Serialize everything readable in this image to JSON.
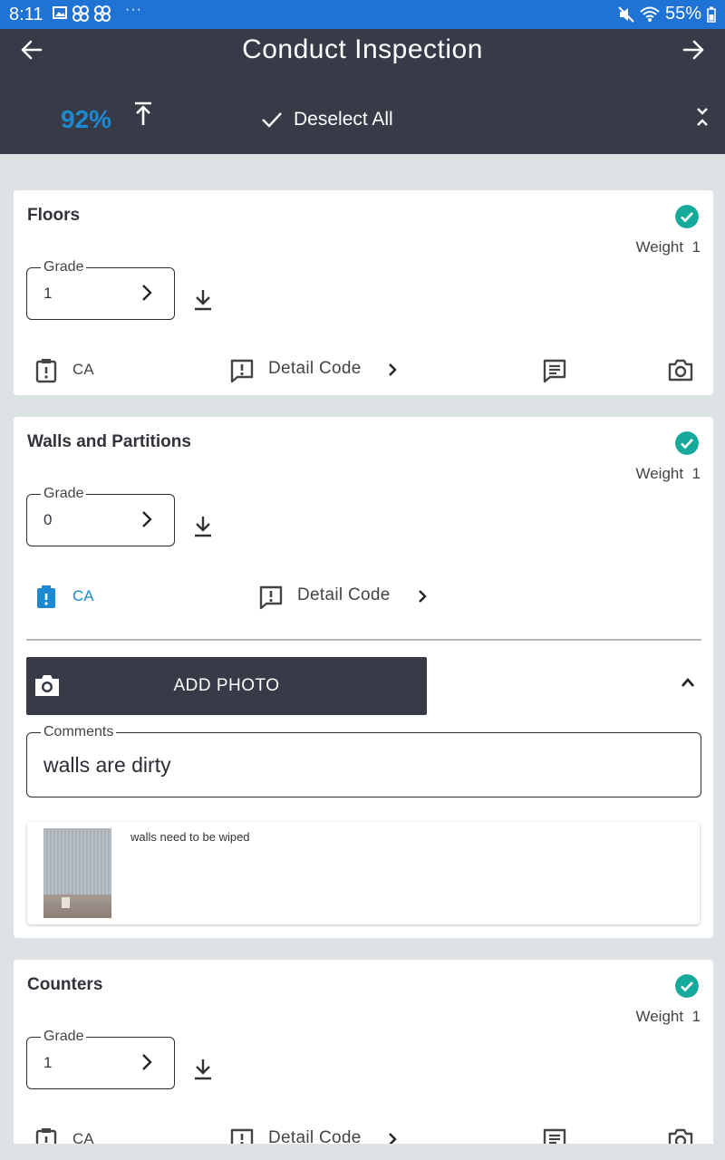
{
  "status_bar": {
    "time": "8:11",
    "battery": "55%",
    "more": "···"
  },
  "header": {
    "title": "Conduct Inspection",
    "progress": "92%",
    "deselect_label": "Deselect All"
  },
  "labels": {
    "grade": "Grade",
    "weight": "Weight",
    "corrective_action": "CA",
    "detail_code": "Detail Code",
    "comments": "Comments",
    "add_photo": "ADD PHOTO"
  },
  "items": [
    {
      "title": "Floors",
      "weight": "1",
      "grade": "1",
      "checked": true
    },
    {
      "title": "Walls and Partitions",
      "weight": "1",
      "grade": "0",
      "checked": true,
      "expanded": true,
      "ca_active": true,
      "comment": "walls are dirty",
      "photo_caption": "walls need to be wiped"
    },
    {
      "title": "Counters",
      "weight": "1",
      "grade": "1",
      "checked": true
    }
  ],
  "colors": {
    "status_bar": "#1f73d4",
    "header": "#363b47",
    "accent_blue": "#1b8ad3",
    "check_green": "#16aa9a",
    "page_bg": "#dde3e5"
  }
}
